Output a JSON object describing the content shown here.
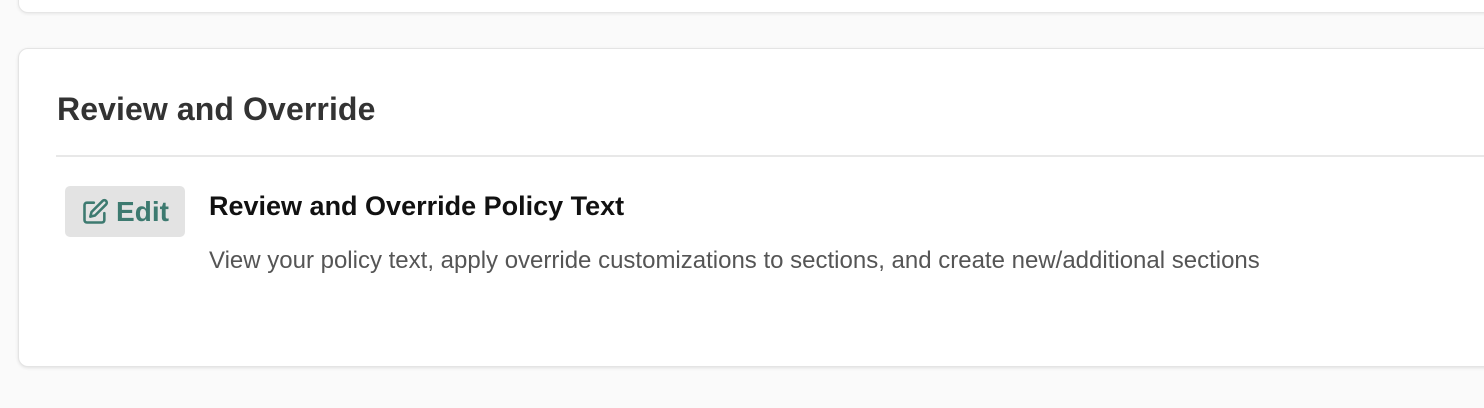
{
  "section": {
    "title": "Review and Override"
  },
  "item": {
    "edit_label": "Edit",
    "edit_icon": "edit-icon",
    "title": "Review and Override Policy Text",
    "description": "View your policy text, apply override customizations to sections, and create new/additional sections"
  },
  "colors": {
    "accent": "#3d7a70",
    "button_bg": "#e3e3e3",
    "title_text": "#333333",
    "body_text": "#555555"
  }
}
